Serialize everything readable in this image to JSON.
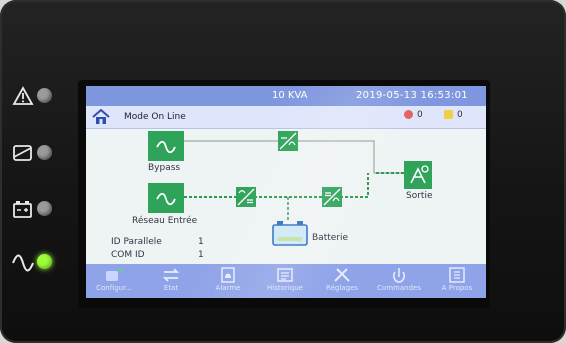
{
  "header": {
    "rating": "10 KVA",
    "datetime": "2019-05-13  16:53:01"
  },
  "mode_bar": {
    "mode_text": "Mode On Line",
    "alarm_count_red": "0",
    "alarm_count_yellow": "0"
  },
  "diagram": {
    "bypass_label": "Bypass",
    "mains_label": "Réseau Entrée",
    "battery_label": "Batterie",
    "output_label": "Sortie",
    "parallel_id_label": "ID Parallele",
    "parallel_id_value": "1",
    "com_id_label": "COM ID",
    "com_id_value": "1"
  },
  "toolbar": {
    "items": [
      {
        "label": "Configur...",
        "icon": "connect-icon"
      },
      {
        "label": "Etat",
        "icon": "transfer-arrows-icon"
      },
      {
        "label": "Alarme",
        "icon": "alarm-icon"
      },
      {
        "label": "Historique",
        "icon": "history-icon"
      },
      {
        "label": "Réglages",
        "icon": "tools-icon"
      },
      {
        "label": "Commandes",
        "icon": "command-icon"
      },
      {
        "label": "A Propos",
        "icon": "about-icon"
      }
    ]
  },
  "indicators": [
    {
      "name": "warning",
      "state": "off"
    },
    {
      "name": "bypass",
      "state": "off"
    },
    {
      "name": "battery",
      "state": "off"
    },
    {
      "name": "ac-line",
      "state": "on"
    }
  ],
  "colors": {
    "header_bar": "#7f97de",
    "toolbar": "#8fa3e8",
    "module_green": "#2fa35a",
    "line_green": "#2c9a4e",
    "led_on": "#9dff3a"
  }
}
